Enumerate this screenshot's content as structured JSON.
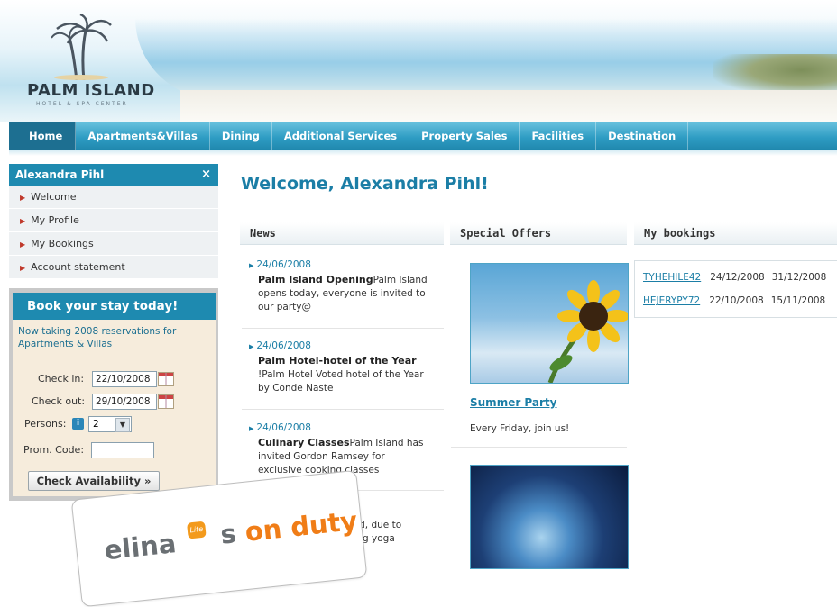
{
  "header": {
    "brand_name": "PALM ISLAND",
    "brand_sub": "HOTEL & SPA CENTER"
  },
  "nav": {
    "items": [
      "Home",
      "Apartments&Villas",
      "Dining",
      "Additional Services",
      "Property Sales",
      "Facilities",
      "Destination"
    ],
    "active": "Home"
  },
  "user_panel": {
    "title": "Alexandra Pihl",
    "close": "×",
    "items": [
      "Welcome",
      "My Profile",
      "My Bookings",
      "Account statement"
    ]
  },
  "book": {
    "title": "Book your stay today!",
    "desc": "Now taking 2008 reservations for Apartments & Villas",
    "checkin_label": "Check in:",
    "checkin_value": "22/10/2008",
    "checkout_label": "Check out:",
    "checkout_value": "29/10/2008",
    "persons_label": "Persons:",
    "persons_info": "i",
    "persons_value": "2",
    "promo_label": "Prom. Code:",
    "promo_value": "",
    "button": "Check Availability »"
  },
  "welcome": "Welcome, Alexandra Pihl!",
  "news": {
    "heading": "News",
    "items": [
      {
        "date": "24/06/2008",
        "title": "Palm Island Opening",
        "text": "Palm Island opens today, everyone is invited to our party@"
      },
      {
        "date": "24/06/2008",
        "title": "Palm Hotel-hotel of the Year",
        "text": "!Palm Hotel Voted hotel of the Year by Conde Naste"
      },
      {
        "date": "24/06/2008",
        "title": "Culinary Classes",
        "text": "Palm Island has invited Gordon Ramsey for exclusive cooking classes"
      },
      {
        "date": "",
        "title": "",
        "text": "m Island, due to"
      },
      {
        "date": "",
        "title": "",
        "text": "e holding yoga"
      }
    ]
  },
  "offers": {
    "heading": "Special Offers",
    "link": "Summer Party",
    "text": "Every Friday, join us!"
  },
  "bookings": {
    "heading": "My bookings",
    "rows": [
      {
        "code": "TYHEHILE42",
        "from": "24/12/2008",
        "to": "31/12/2008"
      },
      {
        "code": "HEJERYPY72",
        "from": "22/10/2008",
        "to": "15/11/2008"
      }
    ]
  },
  "sticker": {
    "elina": "elina",
    "lite": "Lite",
    "s": "s",
    "on_duty": "on duty"
  }
}
